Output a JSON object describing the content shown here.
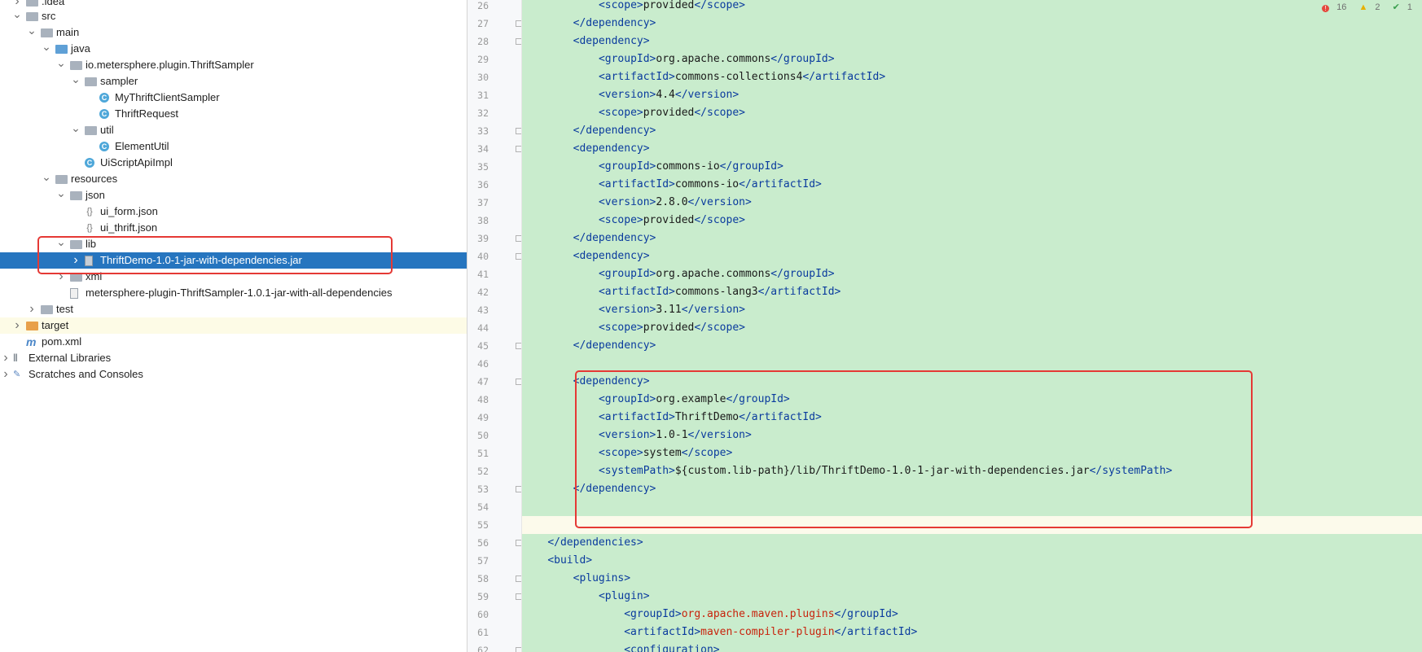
{
  "project_tree": {
    "items": [
      {
        "label": ".idea",
        "icon": "folder-icon",
        "arrow": "chevron-right-icon"
      },
      {
        "label": "src",
        "icon": "folder-icon",
        "arrow": "chevron-down-icon"
      },
      {
        "label": "main",
        "icon": "folder-icon",
        "arrow": "chevron-down-icon"
      },
      {
        "label": "java",
        "icon": "source-folder-icon",
        "arrow": "chevron-down-icon"
      },
      {
        "label": "io.metersphere.plugin.ThriftSampler",
        "icon": "package-icon",
        "arrow": "chevron-down-icon"
      },
      {
        "label": "sampler",
        "icon": "package-icon",
        "arrow": "chevron-down-icon"
      },
      {
        "label": "MyThriftClientSampler",
        "icon": "class-icon"
      },
      {
        "label": "ThriftRequest",
        "icon": "class-icon"
      },
      {
        "label": "util",
        "icon": "package-icon",
        "arrow": "chevron-down-icon"
      },
      {
        "label": "ElementUtil",
        "icon": "class-icon"
      },
      {
        "label": "UiScriptApiImpl",
        "icon": "class-icon"
      },
      {
        "label": "resources",
        "icon": "resources-folder-icon",
        "arrow": "chevron-down-icon"
      },
      {
        "label": "json",
        "icon": "folder-icon",
        "arrow": "chevron-down-icon"
      },
      {
        "label": "ui_form.json",
        "icon": "json-file-icon"
      },
      {
        "label": "ui_thrift.json",
        "icon": "json-file-icon"
      },
      {
        "label": "lib",
        "icon": "folder-icon",
        "arrow": "chevron-down-icon"
      },
      {
        "label": "ThriftDemo-1.0-1-jar-with-dependencies.jar",
        "icon": "jar-icon",
        "arrow": "chevron-right-icon",
        "selected": true
      },
      {
        "label": "xml",
        "icon": "folder-icon",
        "arrow": "chevron-right-icon"
      },
      {
        "label": "metersphere-plugin-ThriftSampler-1.0.1-jar-with-all-dependencies",
        "icon": "file-icon"
      },
      {
        "label": "test",
        "icon": "folder-icon",
        "arrow": "chevron-right-icon"
      },
      {
        "label": "target",
        "icon": "excluded-folder-icon",
        "arrow": "chevron-right-icon"
      },
      {
        "label": "pom.xml",
        "icon": "maven-icon"
      },
      {
        "label": "External Libraries",
        "icon": "libraries-icon",
        "arrow": "chevron-right-icon"
      },
      {
        "label": "Scratches and Consoles",
        "icon": "scratches-icon",
        "arrow": "chevron-right-icon"
      }
    ]
  },
  "editor": {
    "inspections": {
      "errors": "16",
      "warnings": "2",
      "ok": "1"
    },
    "lines": [
      {
        "no": "26",
        "parts": [
          [
            "pad",
            "        "
          ],
          [
            "tag",
            "<scope>"
          ],
          [
            "val",
            "provided"
          ],
          [
            "tag",
            "</scope>"
          ]
        ]
      },
      {
        "no": "27",
        "parts": [
          [
            "pad",
            "    "
          ],
          [
            "tag",
            "</dependency>"
          ]
        ]
      },
      {
        "no": "28",
        "parts": [
          [
            "pad",
            "    "
          ],
          [
            "tag",
            "<dependency>"
          ]
        ]
      },
      {
        "no": "29",
        "parts": [
          [
            "pad",
            "        "
          ],
          [
            "tag",
            "<groupId>"
          ],
          [
            "val",
            "org.apache.commons"
          ],
          [
            "tag",
            "</groupId>"
          ]
        ]
      },
      {
        "no": "30",
        "parts": [
          [
            "pad",
            "        "
          ],
          [
            "tag",
            "<artifactId>"
          ],
          [
            "val",
            "commons-collections4"
          ],
          [
            "tag",
            "</artifactId>"
          ]
        ]
      },
      {
        "no": "31",
        "parts": [
          [
            "pad",
            "        "
          ],
          [
            "tag",
            "<version>"
          ],
          [
            "val",
            "4.4"
          ],
          [
            "tag",
            "</version>"
          ]
        ]
      },
      {
        "no": "32",
        "parts": [
          [
            "pad",
            "        "
          ],
          [
            "tag",
            "<scope>"
          ],
          [
            "val",
            "provided"
          ],
          [
            "tag",
            "</scope>"
          ]
        ]
      },
      {
        "no": "33",
        "parts": [
          [
            "pad",
            "    "
          ],
          [
            "tag",
            "</dependency>"
          ]
        ]
      },
      {
        "no": "34",
        "parts": [
          [
            "pad",
            "    "
          ],
          [
            "tag",
            "<dependency>"
          ]
        ]
      },
      {
        "no": "35",
        "parts": [
          [
            "pad",
            "        "
          ],
          [
            "tag",
            "<groupId>"
          ],
          [
            "val",
            "commons-io"
          ],
          [
            "tag",
            "</groupId>"
          ]
        ]
      },
      {
        "no": "36",
        "parts": [
          [
            "pad",
            "        "
          ],
          [
            "tag",
            "<artifactId>"
          ],
          [
            "val",
            "commons-io"
          ],
          [
            "tag",
            "</artifactId>"
          ]
        ]
      },
      {
        "no": "37",
        "parts": [
          [
            "pad",
            "        "
          ],
          [
            "tag",
            "<version>"
          ],
          [
            "val",
            "2.8.0"
          ],
          [
            "tag",
            "</version>"
          ]
        ]
      },
      {
        "no": "38",
        "parts": [
          [
            "pad",
            "        "
          ],
          [
            "tag",
            "<scope>"
          ],
          [
            "val",
            "provided"
          ],
          [
            "tag",
            "</scope>"
          ]
        ]
      },
      {
        "no": "39",
        "parts": [
          [
            "pad",
            "    "
          ],
          [
            "tag",
            "</dependency>"
          ]
        ]
      },
      {
        "no": "40",
        "parts": [
          [
            "pad",
            "    "
          ],
          [
            "tag",
            "<dependency>"
          ]
        ]
      },
      {
        "no": "41",
        "parts": [
          [
            "pad",
            "        "
          ],
          [
            "tag",
            "<groupId>"
          ],
          [
            "val",
            "org.apache.commons"
          ],
          [
            "tag",
            "</groupId>"
          ]
        ]
      },
      {
        "no": "42",
        "parts": [
          [
            "pad",
            "        "
          ],
          [
            "tag",
            "<artifactId>"
          ],
          [
            "val",
            "commons-lang3"
          ],
          [
            "tag",
            "</artifactId>"
          ]
        ]
      },
      {
        "no": "43",
        "parts": [
          [
            "pad",
            "        "
          ],
          [
            "tag",
            "<version>"
          ],
          [
            "val",
            "3.11"
          ],
          [
            "tag",
            "</version>"
          ]
        ]
      },
      {
        "no": "44",
        "parts": [
          [
            "pad",
            "        "
          ],
          [
            "tag",
            "<scope>"
          ],
          [
            "val",
            "provided"
          ],
          [
            "tag",
            "</scope>"
          ]
        ]
      },
      {
        "no": "45",
        "parts": [
          [
            "pad",
            "    "
          ],
          [
            "tag",
            "</dependency>"
          ]
        ]
      },
      {
        "no": "46",
        "parts": []
      },
      {
        "no": "47",
        "parts": [
          [
            "pad",
            "    "
          ],
          [
            "tag",
            "<dependency>"
          ]
        ]
      },
      {
        "no": "48",
        "parts": [
          [
            "pad",
            "        "
          ],
          [
            "tag",
            "<groupId>"
          ],
          [
            "val",
            "org.example"
          ],
          [
            "tag",
            "</groupId>"
          ]
        ]
      },
      {
        "no": "49",
        "parts": [
          [
            "pad",
            "        "
          ],
          [
            "tag",
            "<artifactId>"
          ],
          [
            "val",
            "ThriftDemo"
          ],
          [
            "tag",
            "</artifactId>"
          ]
        ]
      },
      {
        "no": "50",
        "parts": [
          [
            "pad",
            "        "
          ],
          [
            "tag",
            "<version>"
          ],
          [
            "val",
            "1.0-1"
          ],
          [
            "tag",
            "</version>"
          ]
        ]
      },
      {
        "no": "51",
        "parts": [
          [
            "pad",
            "        "
          ],
          [
            "tag",
            "<scope>"
          ],
          [
            "val",
            "system"
          ],
          [
            "tag",
            "</scope>"
          ]
        ]
      },
      {
        "no": "52",
        "parts": [
          [
            "pad",
            "        "
          ],
          [
            "tag",
            "<systemPath>"
          ],
          [
            "val",
            "${custom.lib-path}/lib/ThriftDemo-1.0-1-jar-with-dependencies.jar"
          ],
          [
            "tag",
            "</systemPath>"
          ]
        ]
      },
      {
        "no": "53",
        "parts": [
          [
            "pad",
            "    "
          ],
          [
            "tag",
            "</dependency>"
          ]
        ]
      },
      {
        "no": "54",
        "parts": []
      },
      {
        "no": "55",
        "parts": [],
        "current": true
      },
      {
        "no": "56",
        "parts": [
          [
            "tag",
            "</dependencies>"
          ]
        ]
      },
      {
        "no": "57",
        "parts": [
          [
            "tag",
            "<build>"
          ]
        ]
      },
      {
        "no": "58",
        "parts": [
          [
            "pad",
            "    "
          ],
          [
            "tag",
            "<plugins>"
          ]
        ]
      },
      {
        "no": "59",
        "parts": [
          [
            "pad",
            "        "
          ],
          [
            "tag",
            "<plugin>"
          ]
        ]
      },
      {
        "no": "60",
        "parts": [
          [
            "pad",
            "            "
          ],
          [
            "tag",
            "<groupId>"
          ],
          [
            "valr",
            "org.apache.maven.plugins"
          ],
          [
            "tag",
            "</groupId>"
          ]
        ]
      },
      {
        "no": "61",
        "parts": [
          [
            "pad",
            "            "
          ],
          [
            "tag",
            "<artifactId>"
          ],
          [
            "valr",
            "maven-compiler-plugin"
          ],
          [
            "tag",
            "</artifactId>"
          ]
        ]
      },
      {
        "no": "62",
        "parts": [
          [
            "pad",
            "            "
          ],
          [
            "tag",
            "<configuration>"
          ]
        ]
      }
    ]
  }
}
